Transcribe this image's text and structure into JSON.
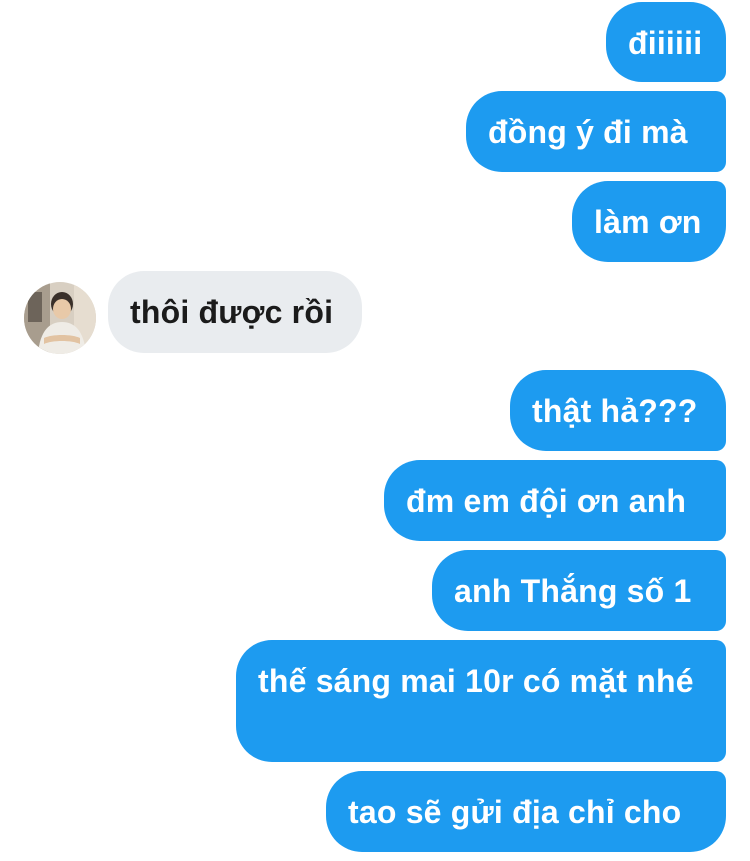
{
  "messages": [
    {
      "sender": "me",
      "text": "điiiiii"
    },
    {
      "sender": "me",
      "text": "đồng ý đi mà"
    },
    {
      "sender": "me",
      "text": "làm ơn"
    },
    {
      "sender": "other",
      "text": "thôi được rồi"
    },
    {
      "sender": "me",
      "text": "thật hả???"
    },
    {
      "sender": "me",
      "text": "đm em đội ơn anh"
    },
    {
      "sender": "me",
      "text": "anh Thắng số 1"
    },
    {
      "sender": "me",
      "text": "thế sáng mai 10r có mặt nhé"
    },
    {
      "sender": "me",
      "text": "tao sẽ gửi địa chỉ cho"
    }
  ],
  "colors": {
    "outgoing_bubble": "#1d9bf0",
    "incoming_bubble": "#e9ecef",
    "outgoing_text": "#ffffff",
    "incoming_text": "#1b1b1b"
  },
  "icons": {
    "avatar": "profile-photo"
  }
}
